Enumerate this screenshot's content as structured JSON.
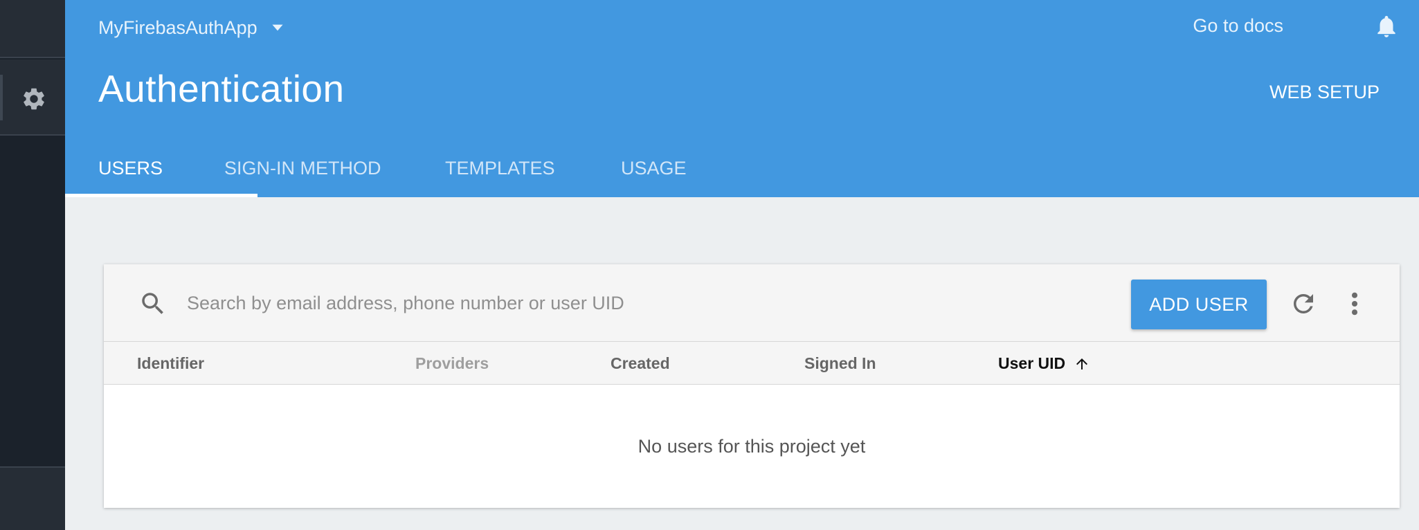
{
  "header": {
    "project_name": "MyFirebasAuthApp",
    "go_to_docs": "Go to docs",
    "title": "Authentication",
    "web_setup": "WEB SETUP",
    "tabs": [
      {
        "label": "USERS",
        "active": true
      },
      {
        "label": "SIGN-IN METHOD",
        "active": false
      },
      {
        "label": "TEMPLATES",
        "active": false
      },
      {
        "label": "USAGE",
        "active": false
      }
    ]
  },
  "toolbar": {
    "search_placeholder": "Search by email address, phone number or user UID",
    "search_value": "",
    "add_user_label": "ADD USER"
  },
  "table": {
    "columns": [
      "Identifier",
      "Providers",
      "Created",
      "Signed In",
      "User UID"
    ],
    "sorted_column": "User UID",
    "sort_direction": "ascending",
    "empty_message": "No users for this project yet"
  },
  "icons": {
    "sidebar": "gear-icon",
    "project": "chevron-down-icon",
    "notifications": "bell-icon",
    "help": "help-icon",
    "search": "search-icon",
    "refresh": "refresh-icon",
    "more": "more-vert-icon",
    "sort": "arrow-up-icon"
  },
  "colors": {
    "brand_blue": "#4298e0",
    "sidebar_dark": "#1b222b",
    "page_background": "#eceff1"
  }
}
